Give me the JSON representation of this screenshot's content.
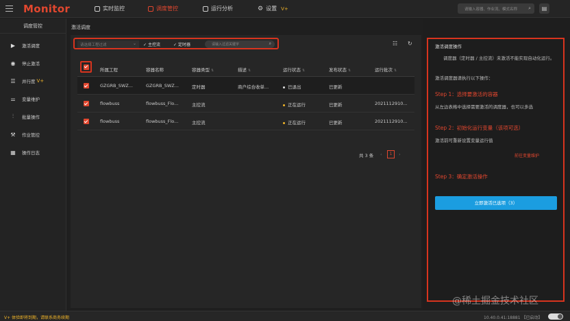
{
  "app": {
    "title": "Monitor"
  },
  "nav": [
    {
      "label": "实时监控",
      "icon": "monitor-icon"
    },
    {
      "label": "调度管控",
      "icon": "schedule-icon"
    },
    {
      "label": "运行分析",
      "icon": "analysis-icon"
    },
    {
      "label": "设置",
      "icon": "gear-icon",
      "badge": "V+"
    }
  ],
  "top_search": {
    "placeholder": "请输入容器、作业流、模式名称"
  },
  "sidebar": {
    "title": "调度管控",
    "items": [
      {
        "label": "激活调度",
        "icon": "play-icon"
      },
      {
        "label": "停止激活",
        "icon": "stop-icon"
      },
      {
        "label": "并行度",
        "icon": "parallel-icon",
        "badge": "V+"
      },
      {
        "label": "变量维护",
        "icon": "variable-icon"
      },
      {
        "label": "批量操作",
        "icon": "batch-icon"
      },
      {
        "label": "作业管控",
        "icon": "job-icon"
      },
      {
        "label": "操作日志",
        "icon": "log-icon"
      }
    ]
  },
  "breadcrumb": "激活调度",
  "filters": {
    "project_placeholder": "请选择工程过滤",
    "check1": "主控流",
    "check2": "定时器",
    "keyword_placeholder": "请输入过滤关键字"
  },
  "table": {
    "columns": [
      "所属工程",
      "容器名称",
      "容器类型",
      "描述",
      "运行状态",
      "发布状态",
      "运行批次"
    ],
    "rows": [
      {
        "project": "GZGRB_SWZ...",
        "container": "GZGRB_SWZ...",
        "type": "定时器",
        "desc": "商户综合收单...",
        "status": "已退出",
        "status_color": "#dddddd",
        "publish": "已更新",
        "batch": ""
      },
      {
        "project": "flowbuss",
        "container": "flowbuss_Flo...",
        "type": "主控流",
        "desc": "",
        "status": "正在运行",
        "status_color": "#f0b429",
        "publish": "已更新",
        "batch": "2021112910..."
      },
      {
        "project": "flowbuss",
        "container": "flowbuss_Flo...",
        "type": "主控流",
        "desc": "",
        "status": "正在运行",
        "status_color": "#f0b429",
        "publish": "已更新",
        "batch": "2021112910..."
      }
    ]
  },
  "pagination": {
    "total": "共 3 条",
    "current": "1"
  },
  "guide": {
    "title": "激活调度操作",
    "intro": "调度器（定时器 / 主控流）未激活不能实现自动化运行。",
    "intro2": "激活调度器请执行以下操作：",
    "step1": "Step 1：选择要激活的容器",
    "step1_text": "从左边表格中选择需要激活的调度器，也可以多选",
    "step2": "Step 2：初始化运行变量（该项可选）",
    "step2_text": "激活前可重新设置变量运行值",
    "step2_link": "前往变量维护",
    "step3": "Step 3：确定激活操作",
    "button": "立即激活已选项（3）"
  },
  "footer": {
    "trial": "V+ 体验即将到期，请联系商务续期",
    "version": "10.40.0.41:18881 【已启动】"
  },
  "watermark": "@稀土掘金技术社区"
}
